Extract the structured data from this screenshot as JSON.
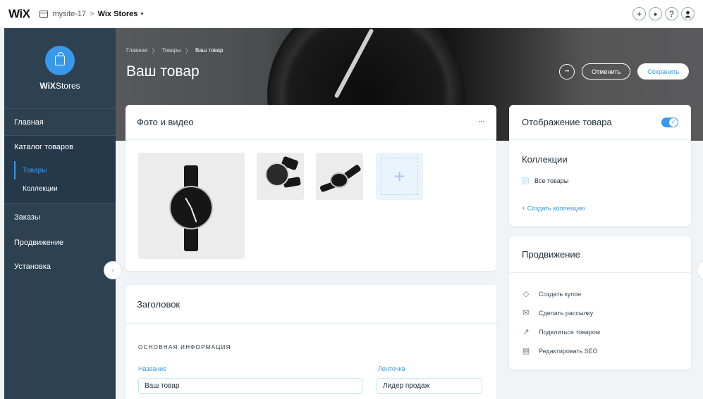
{
  "topbar": {
    "logo": "WiX",
    "site_name": "mysite-17",
    "separator": ">",
    "app_name": "Wix Stores",
    "app_caret": "▾",
    "icons": [
      "plus-icon",
      "bell-icon",
      "help-icon",
      "user-icon"
    ],
    "icon_glyphs": {
      "plus": "+",
      "bell": "●",
      "help": "?",
      "user": "👤"
    }
  },
  "sidebar": {
    "brand_bold": "WiX",
    "brand_rest": "Stores",
    "items": [
      {
        "label": "Главная"
      },
      {
        "label": "Каталог товаров",
        "children": [
          {
            "label": "Товары",
            "active": true
          },
          {
            "label": "Коллекции"
          }
        ]
      },
      {
        "label": "Заказы"
      },
      {
        "label": "Продвижение"
      },
      {
        "label": "Установка"
      }
    ],
    "collapse_glyph": "‹"
  },
  "hero": {
    "breadcrumbs": [
      "Главная",
      "Товары",
      "Ваш товар"
    ],
    "crumb_sep": "〉",
    "title": "Ваш товар",
    "more_glyph": "•••",
    "cancel_label": "Отменить",
    "save_label": "Сохранить"
  },
  "photos": {
    "title": "Фото и видео",
    "more_glyph": "•••",
    "add_glyph": "+"
  },
  "title_section": {
    "title": "Заголовок",
    "section_label": "ОСНОВНАЯ ИНФОРМАЦИЯ",
    "name_label": "Название",
    "name_value": "Ваш товар",
    "ribbon_label": "Ленточка",
    "ribbon_value": "Лидер продаж"
  },
  "display": {
    "title": "Отображение товара",
    "toggle_on": true,
    "collections_title": "Коллекции",
    "all_products": "Все товары",
    "create_collection": "+ Создать коллекцию"
  },
  "promotion": {
    "title": "Продвижение",
    "items": [
      {
        "icon": "coupon-icon",
        "glyph": "◇",
        "label": "Создать купон"
      },
      {
        "icon": "mail-icon",
        "glyph": "✉",
        "label": "Сделать рассылку"
      },
      {
        "icon": "share-icon",
        "glyph": "↗",
        "label": "Поделиться товаром"
      },
      {
        "icon": "seo-icon",
        "glyph": "▤",
        "label": "Редактировать SEO"
      }
    ]
  },
  "colors": {
    "accent": "#3899ec",
    "sidebar": "#2d4150",
    "sidebar_group": "#25394a",
    "page_bg": "#f0f4f7"
  }
}
